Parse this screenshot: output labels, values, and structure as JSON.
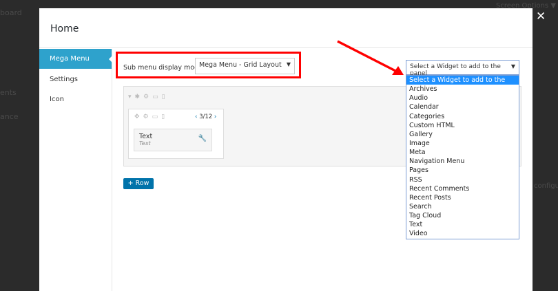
{
  "background": {
    "items": [
      "board",
      "ents",
      "ance"
    ],
    "screen_options": "Screen Options ▼",
    "right_text": "configura"
  },
  "modal": {
    "title": "Home",
    "close": "✕"
  },
  "sidebar": {
    "items": [
      {
        "label": "Mega Menu",
        "active": true
      },
      {
        "label": "Settings"
      },
      {
        "label": "Icon"
      }
    ]
  },
  "display_mode": {
    "label": "Sub menu display mode",
    "value": "Mega Menu - Grid Layout"
  },
  "column": {
    "span": "3/12",
    "prev": "‹",
    "next": "›"
  },
  "widget": {
    "title": "Text",
    "subtitle": "Text"
  },
  "row_button": "+ Row",
  "widget_select": {
    "value": "Select a Widget to add to the panel",
    "options": [
      "Select a Widget to add to the panel",
      "Archives",
      "Audio",
      "Calendar",
      "Categories",
      "Custom HTML",
      "Gallery",
      "Image",
      "Meta",
      "Navigation Menu",
      "Pages",
      "RSS",
      "Recent Comments",
      "Recent Posts",
      "Search",
      "Tag Cloud",
      "Text",
      "Video"
    ]
  },
  "colors": {
    "accent": "#2ea2cc",
    "highlight": "#1e90ff",
    "annotation": "#ff0000",
    "button": "#0073aa"
  }
}
